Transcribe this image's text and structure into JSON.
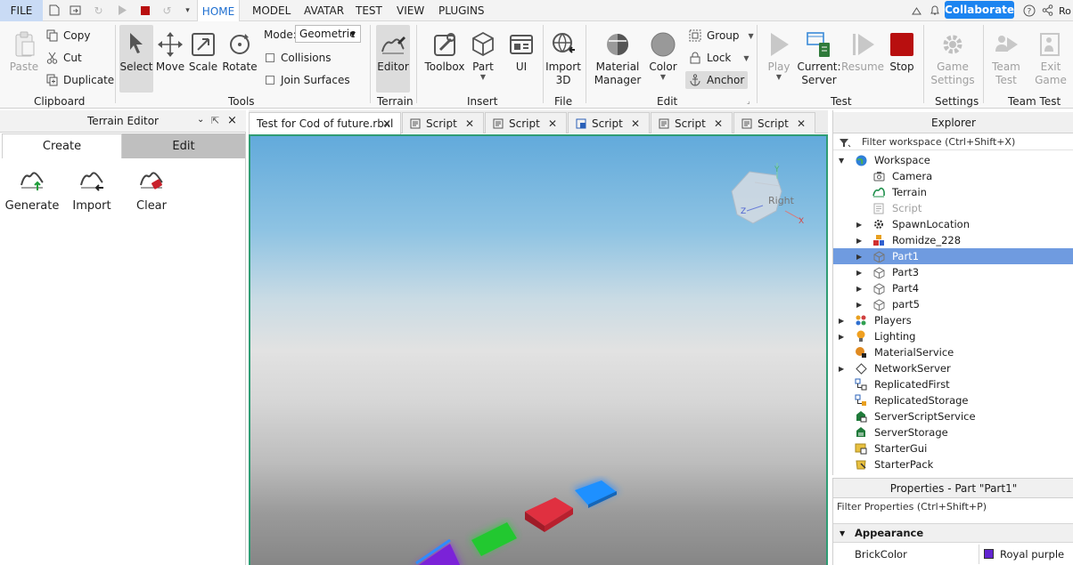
{
  "menubar": {
    "file": "FILE",
    "tabs": [
      "HOME",
      "MODEL",
      "AVATAR",
      "TEST",
      "VIEW",
      "PLUGINS"
    ],
    "collaborate": "Collaborate",
    "user_initials": "Ro"
  },
  "ribbon": {
    "clipboard": {
      "paste": "Paste",
      "copy": "Copy",
      "cut": "Cut",
      "duplicate": "Duplicate",
      "group": "Clipboard"
    },
    "tools": {
      "select": "Select",
      "move": "Move",
      "scale": "Scale",
      "rotate": "Rotate",
      "mode_label": "Mode:",
      "mode_value": "Geometric",
      "collisions": "Collisions",
      "join_surfaces": "Join Surfaces",
      "group": "Tools"
    },
    "terrain": {
      "editor": "Editor",
      "group": "Terrain"
    },
    "insert": {
      "toolbox": "Toolbox",
      "part": "Part",
      "ui": "UI",
      "group": "Insert"
    },
    "file": {
      "import_line1": "Import",
      "import_line2": "3D",
      "group": "File"
    },
    "edit": {
      "material_line1": "Material",
      "material_line2": "Manager",
      "color": "Color",
      "group_btn": "Group",
      "lock": "Lock",
      "anchor": "Anchor",
      "group": "Edit"
    },
    "test": {
      "play": "Play",
      "current_line1": "Current:",
      "current_line2": "Server",
      "resume": "Resume",
      "stop": "Stop",
      "group": "Test"
    },
    "settings": {
      "game_line1": "Game",
      "game_line2": "Settings",
      "group": "Settings"
    },
    "team_test": {
      "team_line1": "Team",
      "team_line2": "Test",
      "exit_line1": "Exit",
      "exit_line2": "Game",
      "group": "Team Test"
    }
  },
  "terrain_editor": {
    "title": "Terrain Editor",
    "tabs": [
      "Create",
      "Edit"
    ],
    "tools": [
      "Generate",
      "Import",
      "Clear"
    ]
  },
  "doc_tabs": [
    "Test for Cod of future.rbxl",
    "Script",
    "Script",
    "Script",
    "Script",
    "Script"
  ],
  "viewport": {
    "cube_label": "Right",
    "axis_y": "Y",
    "axis_z": "Z",
    "axis_x": "X"
  },
  "explorer": {
    "title": "Explorer",
    "filter": "Filter workspace (Ctrl+Shift+X)",
    "items": [
      {
        "label": "Workspace",
        "icon": "workspace-icon"
      },
      {
        "label": "Camera",
        "icon": "camera-icon"
      },
      {
        "label": "Terrain",
        "icon": "terrain-icon"
      },
      {
        "label": "Script",
        "icon": "script-icon"
      },
      {
        "label": "SpawnLocation",
        "icon": "spawn-icon"
      },
      {
        "label": "Romidze_228",
        "icon": "model-icon"
      },
      {
        "label": "Part1",
        "icon": "part-icon"
      },
      {
        "label": "Part3",
        "icon": "part-icon"
      },
      {
        "label": "Part4",
        "icon": "part-icon"
      },
      {
        "label": "part5",
        "icon": "part-icon"
      },
      {
        "label": "Players",
        "icon": "players-icon"
      },
      {
        "label": "Lighting",
        "icon": "lighting-icon"
      },
      {
        "label": "MaterialService",
        "icon": "material-service-icon"
      },
      {
        "label": "NetworkServer",
        "icon": "network-icon"
      },
      {
        "label": "ReplicatedFirst",
        "icon": "replicated-first-icon"
      },
      {
        "label": "ReplicatedStorage",
        "icon": "replicated-storage-icon"
      },
      {
        "label": "ServerScriptService",
        "icon": "server-script-icon"
      },
      {
        "label": "ServerStorage",
        "icon": "server-storage-icon"
      },
      {
        "label": "StarterGui",
        "icon": "starter-gui-icon"
      },
      {
        "label": "StarterPack",
        "icon": "starter-pack-icon"
      }
    ]
  },
  "properties": {
    "title": "Properties - Part \"Part1\"",
    "filter": "Filter Properties (Ctrl+Shift+P)",
    "section": "Appearance",
    "rows": [
      {
        "name": "BrickColor",
        "value": "Royal purple",
        "swatch": "#6225d1"
      }
    ]
  }
}
